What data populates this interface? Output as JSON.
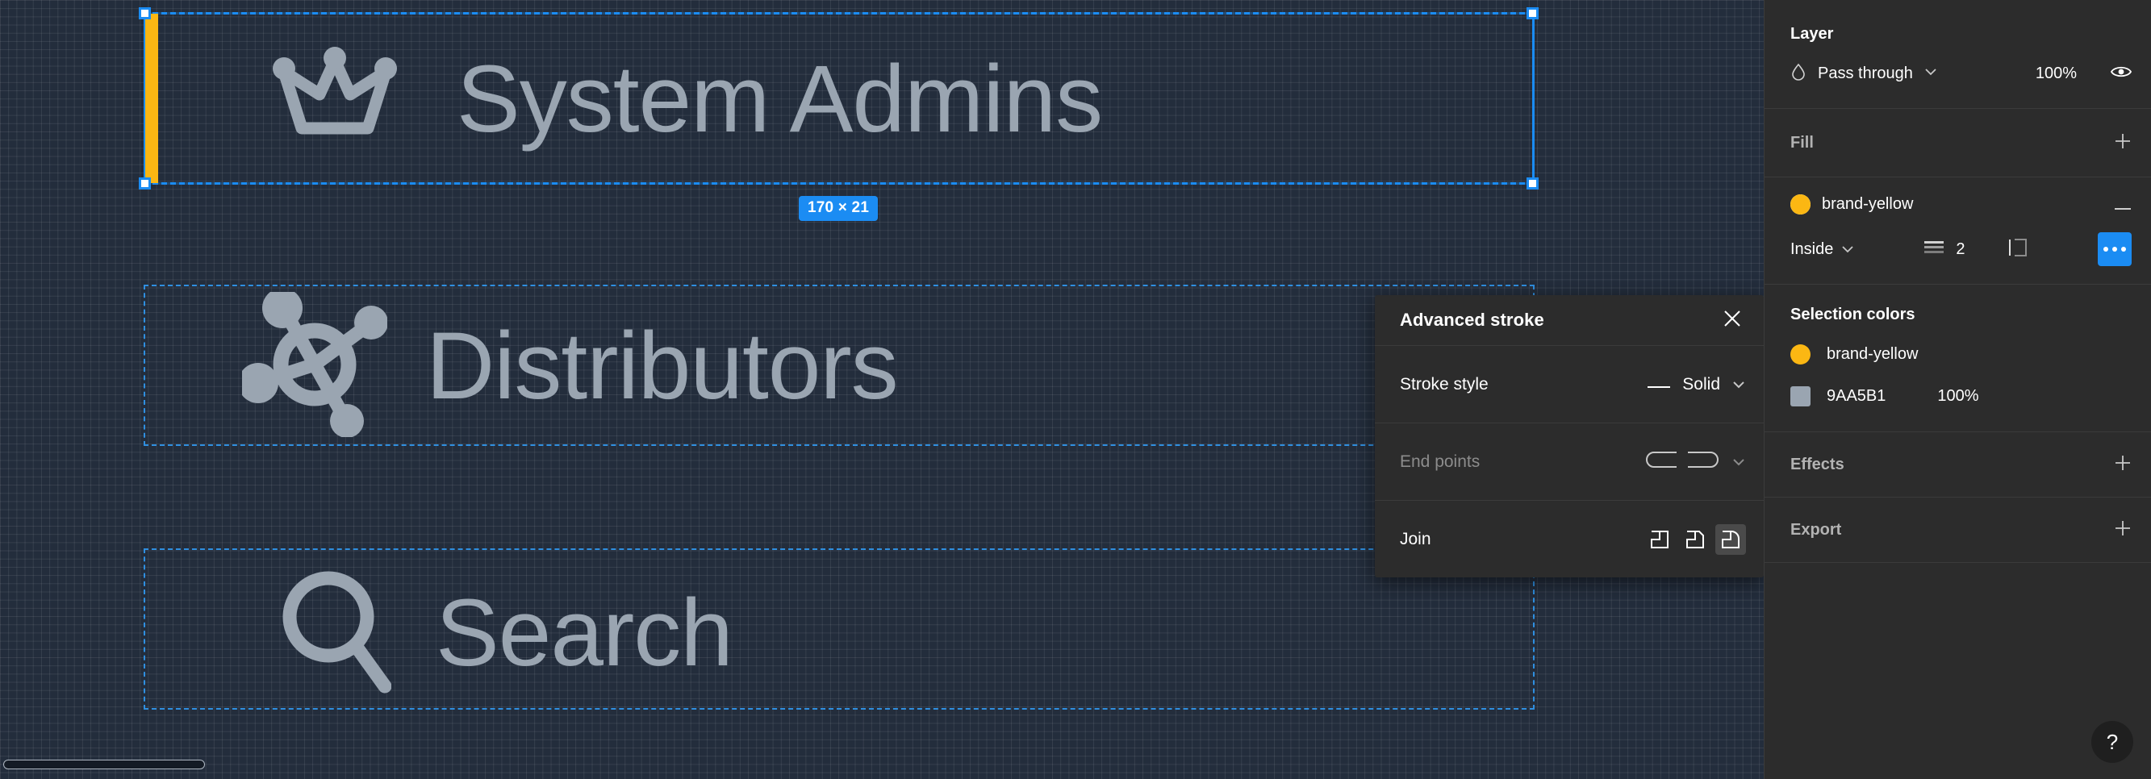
{
  "canvas": {
    "selection_size_badge": "170 × 21",
    "items": [
      {
        "icon": "crown-icon",
        "label": "System Admins",
        "selected": true
      },
      {
        "icon": "hub-icon",
        "label": "Distributors",
        "selected": false
      },
      {
        "icon": "search-icon",
        "label": "Search",
        "selected": false
      }
    ],
    "label_color": "#9AA5B1",
    "selection_color": "#1B8CF3",
    "accent_yellow": "#FBB713"
  },
  "popover": {
    "title": "Advanced stroke",
    "close_icon": "close-icon",
    "rows": [
      {
        "label": "Stroke style",
        "value": "Solid",
        "icon": "solid-line-icon",
        "chevron": "chevron-down-icon",
        "disabled": false
      },
      {
        "label": "End points",
        "value": "",
        "icon": "round-cap-icon",
        "chevron": "chevron-down-icon",
        "disabled": true
      },
      {
        "label": "Join",
        "value": "",
        "icon": "",
        "chevron": "",
        "disabled": false
      }
    ],
    "join_options": [
      {
        "name": "join-miter-icon",
        "active": false
      },
      {
        "name": "join-bevel-icon",
        "active": false
      },
      {
        "name": "join-round-icon",
        "active": true
      }
    ]
  },
  "panel": {
    "layer": {
      "title": "Layer",
      "blend_icon": "blend-mode-icon",
      "blend_mode": "Pass through",
      "chevron": "chevron-down-icon",
      "opacity": "100%",
      "visibility_icon": "eye-icon"
    },
    "fill": {
      "title": "Fill",
      "add_icon": "plus-icon"
    },
    "stroke": {
      "color_name": "brand-yellow",
      "color_hex": "#FBB713",
      "remove_icon": "minus-icon",
      "align": "Inside",
      "align_chevron": "chevron-down-icon",
      "weight_icon": "stroke-weight-icon",
      "weight": "2",
      "dash_icon": "stroke-sides-icon",
      "more_icon": "more-options-icon"
    },
    "selection_colors": {
      "title": "Selection colors",
      "items": [
        {
          "name": "brand-yellow",
          "hex": "#FBB713",
          "opacity": "",
          "type": "dot"
        },
        {
          "name": "9AA5B1",
          "hex": "#9AA5B1",
          "opacity": "100%",
          "type": "square"
        }
      ]
    },
    "effects": {
      "title": "Effects",
      "add_icon": "plus-icon"
    },
    "export": {
      "title": "Export",
      "add_icon": "plus-icon"
    },
    "help": {
      "glyph": "?",
      "name": "help-icon"
    }
  }
}
